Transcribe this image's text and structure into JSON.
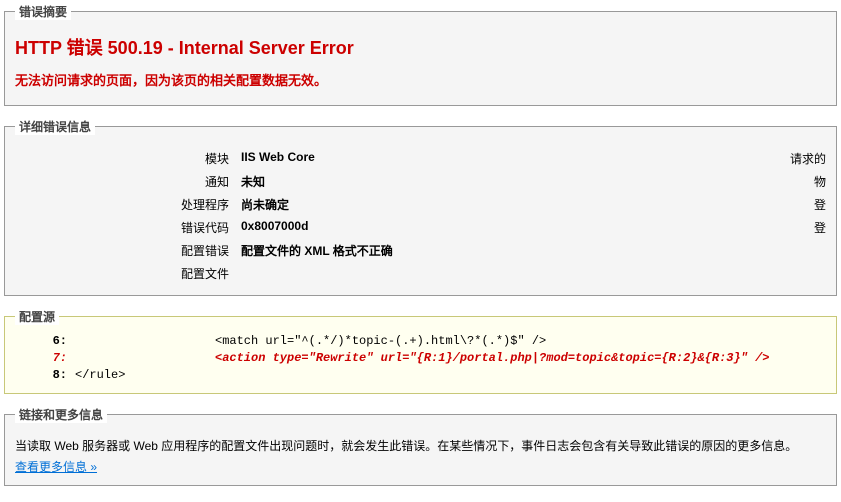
{
  "summary": {
    "legend": "错误摘要",
    "title": "HTTP 错误 500.19 - Internal Server Error",
    "description": "无法访问请求的页面，因为该页的相关配置数据无效。"
  },
  "detail": {
    "legend": "详细错误信息",
    "rows": [
      {
        "label": "模块",
        "value": "IIS Web Core",
        "right": "请求的"
      },
      {
        "label": "通知",
        "value": "未知",
        "right": "物"
      },
      {
        "label": "处理程序",
        "value": "尚未确定",
        "right": "登"
      },
      {
        "label": "错误代码",
        "value": "0x8007000d",
        "right": "登"
      },
      {
        "label": "配置错误",
        "value": "配置文件的 XML 格式不正确",
        "right": ""
      },
      {
        "label": "配置文件",
        "value": " ",
        "right": ""
      }
    ]
  },
  "config_source": {
    "legend": "配置源",
    "lines": [
      {
        "num": "6:",
        "indent": true,
        "text": "<match url=\"^(.*/)*topic-(.+).html\\?*(.*)$\" />",
        "error": false
      },
      {
        "num": "7:",
        "indent": true,
        "text": "<action type=\"Rewrite\" url=\"{R:1}/portal.php|?mod=topic&topic={R:2}&{R:3}\" />",
        "error": true
      },
      {
        "num": "8:",
        "indent": false,
        "text": "</rule>",
        "error": false
      }
    ]
  },
  "links": {
    "legend": "链接和更多信息",
    "text": "当读取 Web 服务器或 Web 应用程序的配置文件出现问题时，就会发生此错误。在某些情况下，事件日志会包含有关导致此错误的原因的更多信息。",
    "link_label": "查看更多信息 »"
  }
}
